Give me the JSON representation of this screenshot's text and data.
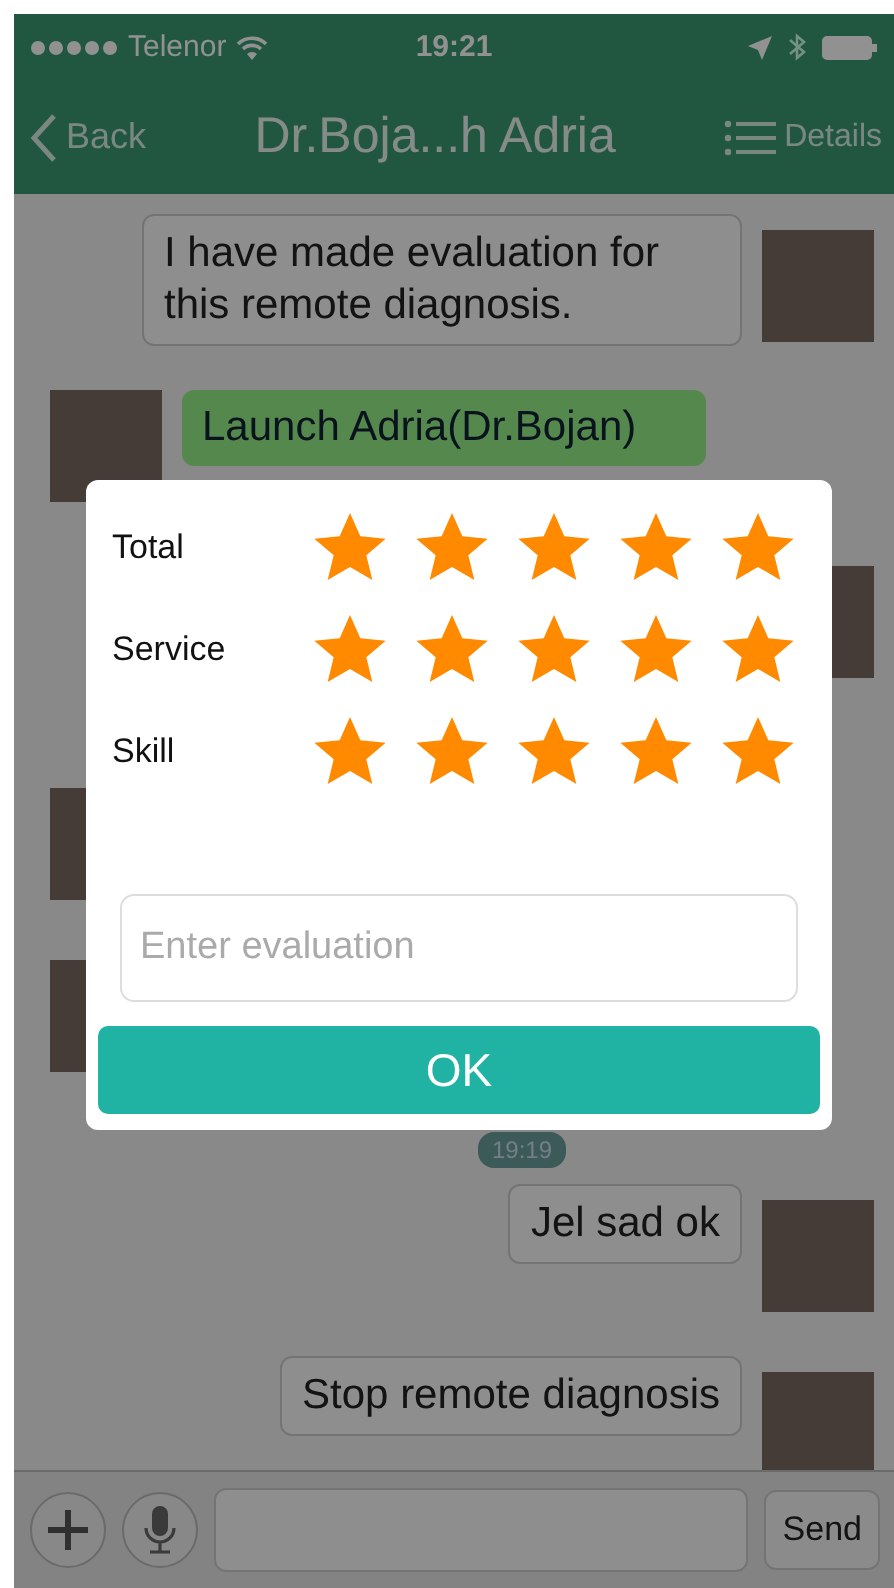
{
  "status_bar": {
    "carrier": "Telenor",
    "time": "19:21"
  },
  "nav_bar": {
    "back": "Back",
    "title": "Dr.Boja...h Adria",
    "details": "Details"
  },
  "messages": [
    {
      "kind": "bubble",
      "outgoing": true,
      "text": "I have made evaluation for this remote diagnosis."
    },
    {
      "kind": "bubble",
      "outgoing": false,
      "text": "Launch Adria(Dr.Bojan)"
    },
    {
      "kind": "avatar",
      "outgoing": true
    },
    {
      "kind": "avatar",
      "outgoing": false
    },
    {
      "kind": "avatar",
      "outgoing": false
    },
    {
      "kind": "time",
      "text": "19:19"
    },
    {
      "kind": "bubble",
      "outgoing": true,
      "text": "Jel sad ok"
    },
    {
      "kind": "bubble",
      "outgoing": true,
      "text": "Stop remote diagnosis"
    }
  ],
  "composer": {
    "send": "Send"
  },
  "rating_dialog": {
    "ratings": [
      {
        "label": "Total",
        "stars": 5
      },
      {
        "label": "Service",
        "stars": 5
      },
      {
        "label": "Skill",
        "stars": 5
      }
    ],
    "placeholder": "Enter evaluation",
    "ok": "OK"
  }
}
